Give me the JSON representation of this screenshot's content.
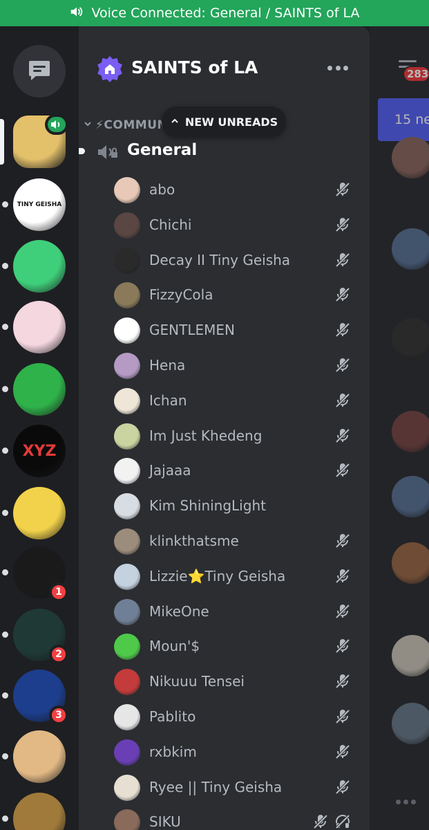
{
  "voice_bar": {
    "text": "Voice Connected: General / SAINTS of LA",
    "icon": "speaker-icon"
  },
  "server": {
    "name": "SAINTS of LA",
    "icon": "home-badge-icon"
  },
  "category": {
    "label": "⚡COMMUN",
    "icon": "chevron-down-icon"
  },
  "new_unreads": {
    "label": "NEW UNREADS",
    "icon": "chevron-up-icon"
  },
  "channel": {
    "name": "General",
    "icon": "speaker-locked-icon"
  },
  "members": [
    {
      "name": "abo",
      "avatar": "#e8c9b7",
      "status": "muted"
    },
    {
      "name": "Chichi",
      "avatar": "#5a4642",
      "status": "muted"
    },
    {
      "name": "Decay II Tiny Geisha",
      "avatar": "#2a2a2a",
      "status": "muted"
    },
    {
      "name": "FizzyCola",
      "avatar": "#8a7a5a",
      "status": "muted"
    },
    {
      "name": "GENTLEMEN",
      "avatar": "#ffffff",
      "status": "muted"
    },
    {
      "name": "Hena",
      "avatar": "#b59ac4",
      "status": "muted"
    },
    {
      "name": "Ichan",
      "avatar": "#efe6d8",
      "status": "muted"
    },
    {
      "name": "Im Just Khedeng",
      "avatar": "#c9d4a0",
      "status": "muted"
    },
    {
      "name": "Jajaaa",
      "avatar": "#f2f2f2",
      "status": "muted"
    },
    {
      "name": "Kim ShiningLight",
      "avatar": "#d8dde3",
      "status": "none"
    },
    {
      "name": "klinkthatsme",
      "avatar": "#9c8c7c",
      "status": "muted"
    },
    {
      "name": "Lizzie⭐Tiny Geisha",
      "avatar": "#c4d2e0",
      "status": "muted"
    },
    {
      "name": "MikeOne",
      "avatar": "#6f7f95",
      "status": "muted"
    },
    {
      "name": "Moun'$",
      "avatar": "#4fc94a",
      "status": "muted"
    },
    {
      "name": "Nikuuu Tensei",
      "avatar": "#c33b3b",
      "status": "muted"
    },
    {
      "name": "Pablito",
      "avatar": "#e6e6e6",
      "status": "muted"
    },
    {
      "name": "rxbkim",
      "avatar": "#6a3fb5",
      "status": "muted"
    },
    {
      "name": "Ryee || Tiny Geisha",
      "avatar": "#e7e0d2",
      "status": "muted"
    },
    {
      "name": "SIKU",
      "avatar": "#8a6a5a",
      "status": "muted-deafened"
    }
  ],
  "servers": [
    {
      "kind": "avatar",
      "color": "#e3c06a",
      "badge": "",
      "voice": true,
      "square": true
    },
    {
      "kind": "avatar",
      "color": "#ffffff",
      "badge": "",
      "voice": false,
      "text": "TINY GEISHA",
      "text_color": "#111111"
    },
    {
      "kind": "avatar",
      "color": "#3fcf7a",
      "badge": "",
      "voice": false
    },
    {
      "kind": "avatar",
      "color": "#f5d7e0",
      "badge": "",
      "voice": false
    },
    {
      "kind": "avatar",
      "color": "#2fb24a",
      "badge": "",
      "voice": false
    },
    {
      "kind": "avatar",
      "color": "#0a0a0a",
      "badge": "",
      "voice": false,
      "text": "XYZ",
      "text_color": "#e23a3a"
    },
    {
      "kind": "avatar",
      "color": "#f2d24a",
      "badge": "",
      "voice": false
    },
    {
      "kind": "avatar",
      "color": "#1a1a1a",
      "badge": "1",
      "voice": false
    },
    {
      "kind": "avatar",
      "color": "#1f3a36",
      "badge": "2",
      "voice": false
    },
    {
      "kind": "avatar",
      "color": "#1c3e8c",
      "badge": "3",
      "voice": false
    },
    {
      "kind": "avatar",
      "color": "#e2b985",
      "badge": "",
      "voice": false
    },
    {
      "kind": "avatar",
      "color": "#a07a3a",
      "badge": "",
      "voice": false
    }
  ],
  "chat_peek": {
    "mention_count": "283",
    "new_messages_label": "15 ne",
    "avatars": [
      "#8d6a62",
      "#5c7396",
      "#3a3a3a",
      "#7a4a4a",
      "#5c7396",
      "#9a6a4a",
      "#c9c2b7",
      "#6a7a8a"
    ]
  },
  "colors": {
    "voice_green": "#23a55a",
    "badge_red": "#f23f42",
    "blurple": "#5865f2",
    "muted_icon": "#b5bac1"
  }
}
